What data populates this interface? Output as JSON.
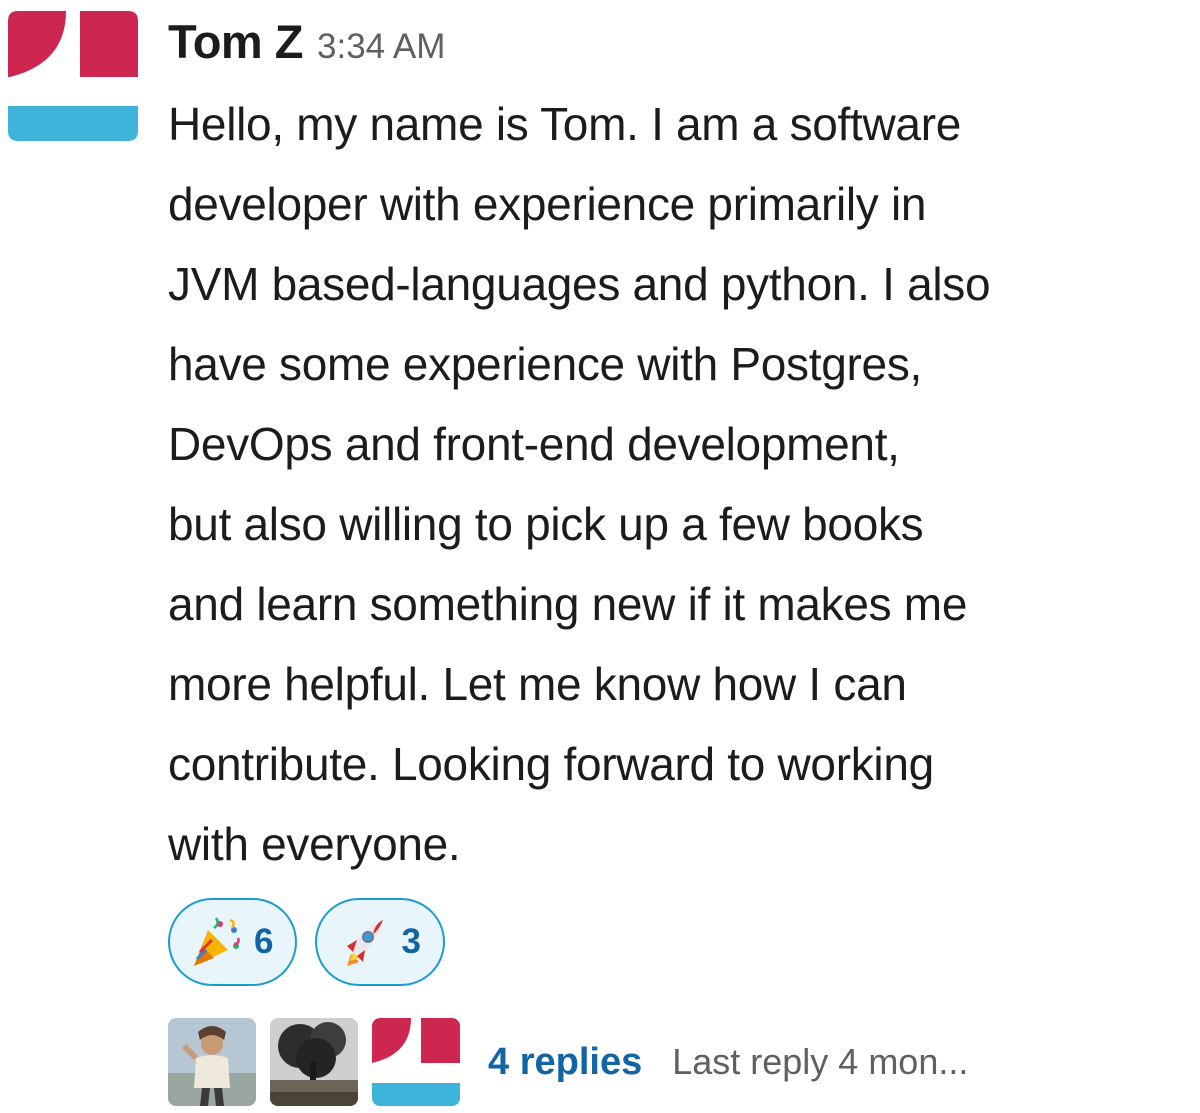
{
  "message": {
    "sender": "Tom Z",
    "timestamp": "3:34 AM",
    "text": "Hello, my name is Tom. I am a software\ndeveloper with experience primarily in\nJVM based-languages and python. I also\nhave some experience with Postgres,\nDevOps and front-end development,\nbut also willing to pick up a few books\nand learn something new if it makes me\nmore helpful. Let me know how I can\ncontribute. Looking forward to working\nwith everyone."
  },
  "reactions": [
    {
      "emoji": "party-popper",
      "count": "6"
    },
    {
      "emoji": "rocket",
      "count": "3"
    }
  ],
  "thread": {
    "replies_label": "4 replies",
    "last_reply": "Last reply 4 mon..."
  },
  "colors": {
    "avatar_red": "#cc2651",
    "avatar_blue": "#3fb4db",
    "link_blue": "#1264a3",
    "reaction_border": "#1d9bd1",
    "reaction_bg": "#e8f5fa"
  }
}
